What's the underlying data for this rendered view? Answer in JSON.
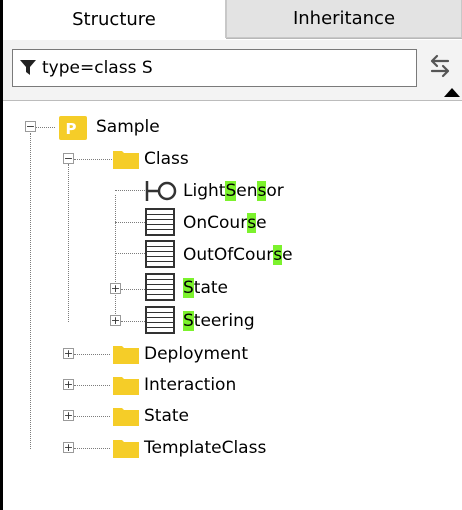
{
  "tabs": {
    "structure": "Structure",
    "inheritance": "Inheritance"
  },
  "filter": {
    "query": "type=class S",
    "filter_icon": "filter-funnel-icon",
    "swap_icon": "swap-arrows-icon"
  },
  "tree": {
    "root": {
      "label": "Sample",
      "icon": "package-icon",
      "expanded": true
    },
    "class_folder": {
      "label": "Class",
      "expanded": true
    },
    "light_sensor": {
      "pre": "Light",
      "hl1": "S",
      "mid": "en",
      "hl2": "s",
      "post": "or",
      "icon": "interface-icon"
    },
    "on_course": {
      "pre": "OnCour",
      "hl": "s",
      "post": "e",
      "icon": "class-icon"
    },
    "out_of_course": {
      "pre": "OutOfCour",
      "hl": "s",
      "post": "e",
      "icon": "class-icon"
    },
    "state_class": {
      "hl": "S",
      "post": "tate",
      "icon": "class-icon",
      "expanded": false
    },
    "steering": {
      "hl": "S",
      "post": "teering",
      "icon": "class-icon",
      "expanded": false
    },
    "folders": [
      {
        "label": "Deployment",
        "expanded": false
      },
      {
        "label": "Interaction",
        "expanded": false
      },
      {
        "label": "State",
        "expanded": false
      },
      {
        "label": "TemplateClass",
        "expanded": false
      }
    ]
  },
  "colors": {
    "highlight": "#7cf22d",
    "folder": "#f5cd28",
    "package": "#f5cd28"
  }
}
